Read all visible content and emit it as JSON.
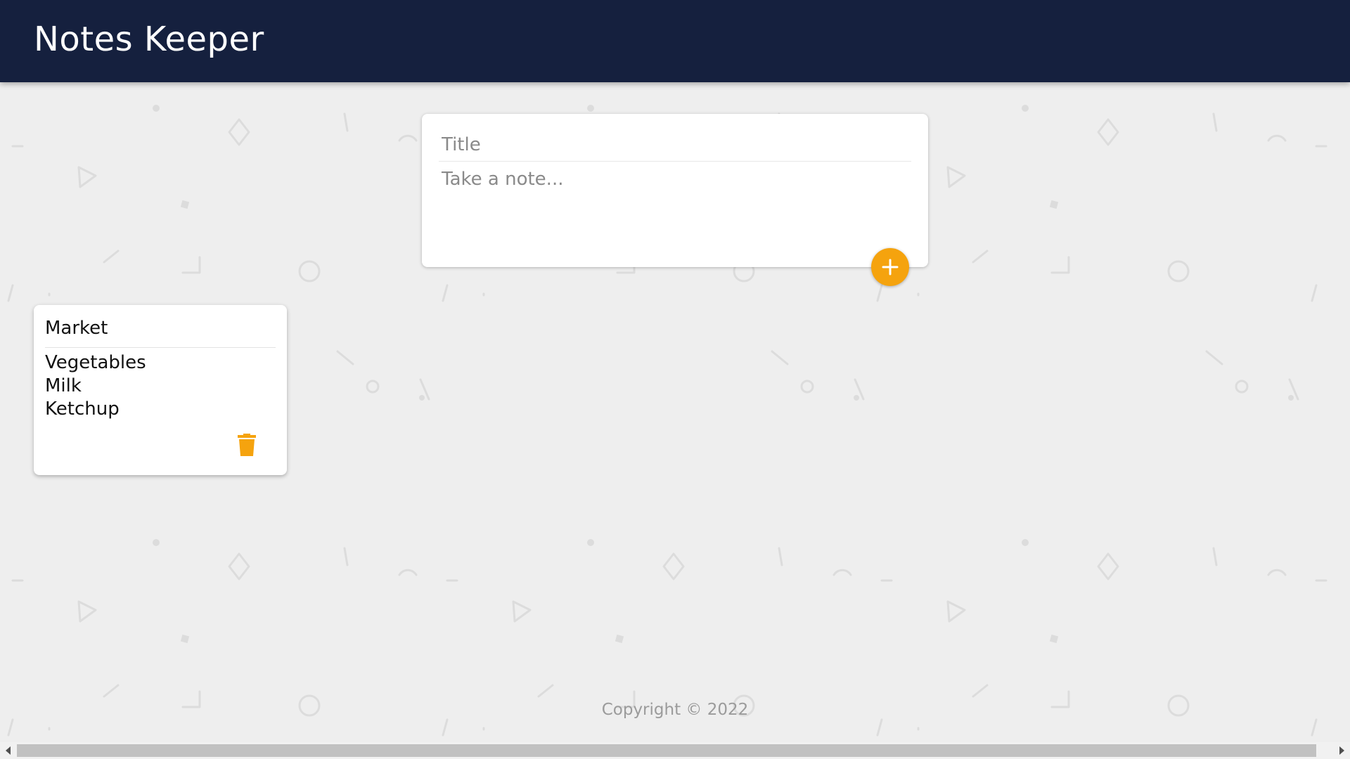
{
  "app": {
    "title": "Notes Keeper"
  },
  "create_note": {
    "title_placeholder": "Title",
    "content_placeholder": "Take a note...",
    "add_icon": "plus-icon"
  },
  "notes": [
    {
      "title": "Market",
      "lines": [
        "Vegetables",
        "Milk",
        "Ketchup"
      ],
      "delete_icon": "trash-icon"
    }
  ],
  "footer": {
    "text": "Copyright © 2022"
  },
  "colors": {
    "header_background": "#15203e",
    "page_background": "#eeeeee",
    "accent": "#f5a30e",
    "card_background": "#ffffff"
  }
}
